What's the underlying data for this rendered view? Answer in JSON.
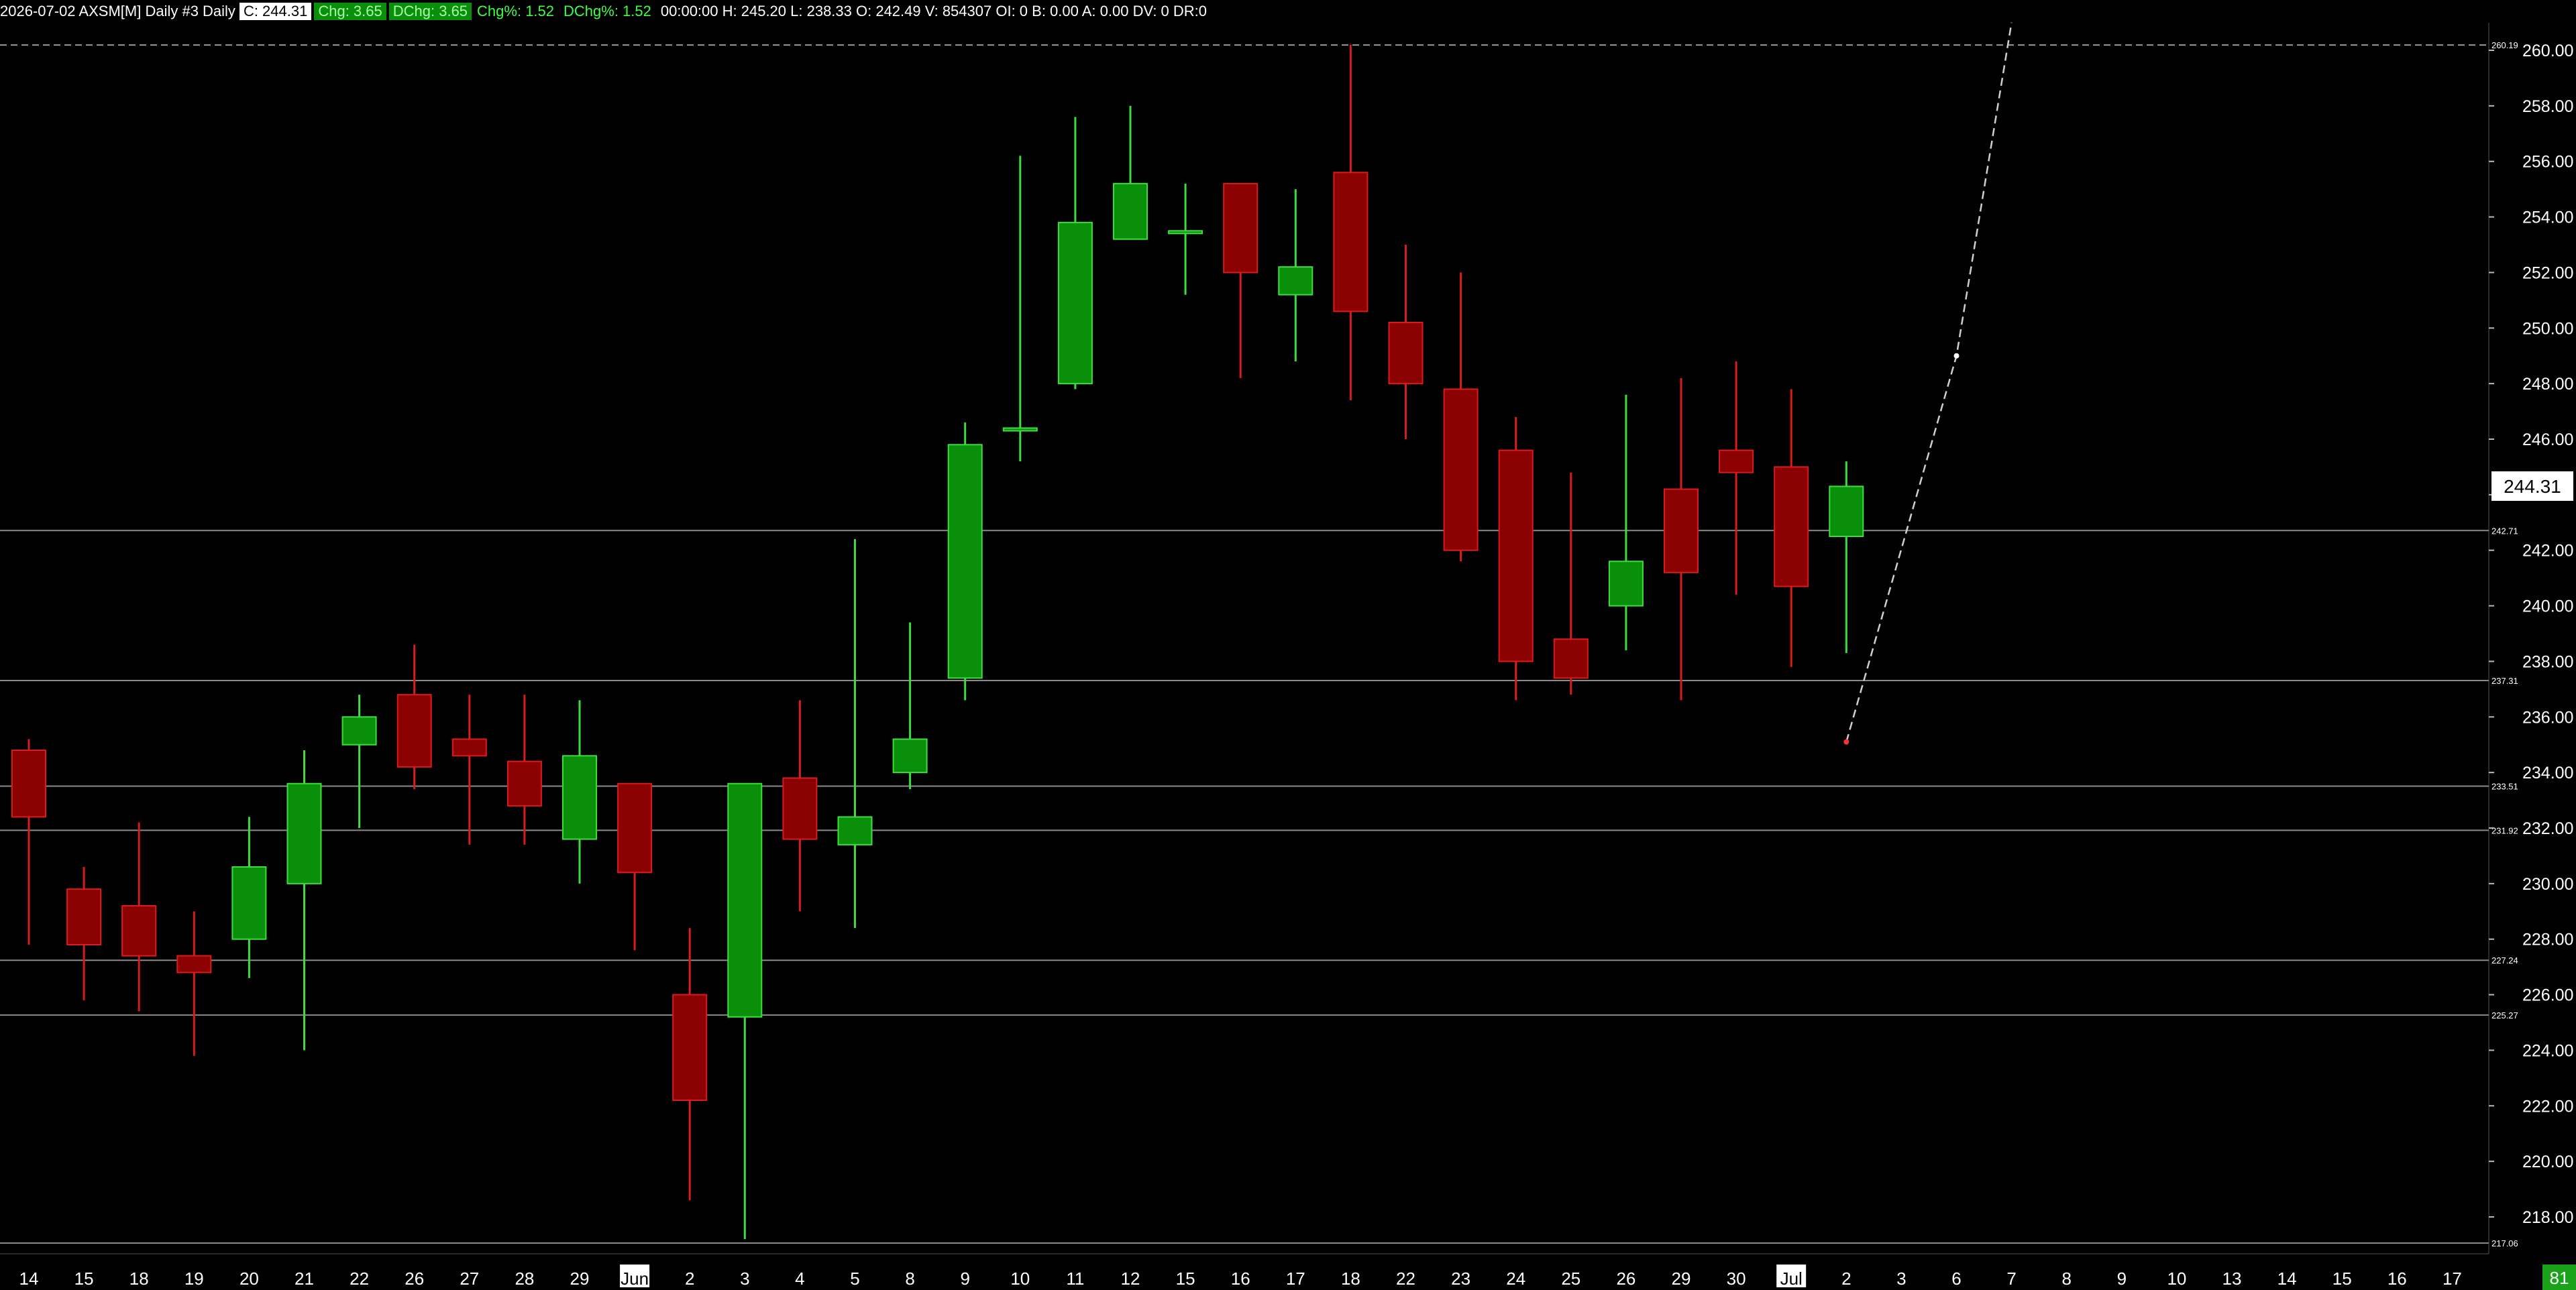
{
  "header": {
    "symbol_line": "2026-07-02 AXSM[M]  Daily #3 Daily",
    "close": "C: 244.31",
    "chg": "Chg: 3.65",
    "dchg": "DChg: 3.65",
    "chgpct": "Chg%: 1.52",
    "dchgpct": "DChg%: 1.52",
    "rest": "00:00:00  H: 245.20  L: 238.33  O: 242.49  V: 854307  OI: 0  B: 0.00  A: 0.00  DV: 0  DR:0"
  },
  "colors": {
    "up": "#0a8f0a",
    "up_wick": "#3ddc3d",
    "down": "#8b0000",
    "down_wick": "#d81b1b",
    "grid": "#8a8a8a",
    "background": "#000000"
  },
  "chart_data": {
    "type": "candlestick",
    "ylim": [
      216.5,
      262.0
    ],
    "y_ticks": [
      218,
      220,
      222,
      224,
      226,
      228,
      230,
      232,
      234,
      236,
      238,
      240,
      242,
      244,
      246,
      248,
      250,
      252,
      254,
      256,
      258,
      260
    ],
    "x_labels": [
      "14",
      "15",
      "18",
      "19",
      "20",
      "21",
      "22",
      "26",
      "27",
      "28",
      "29",
      "Jun",
      "2",
      "3",
      "4",
      "5",
      "8",
      "9",
      "10",
      "11",
      "12",
      "15",
      "16",
      "17",
      "18",
      "22",
      "23",
      "24",
      "25",
      "26",
      "29",
      "30",
      "Jul",
      "2",
      "3",
      "6",
      "7",
      "8",
      "9",
      "10",
      "13",
      "14",
      "15",
      "16",
      "17"
    ],
    "x_labels_highlighted": [
      "Jun",
      "Jul"
    ],
    "candles": [
      {
        "o": 234.8,
        "h": 235.2,
        "l": 227.8,
        "c": 232.4
      },
      {
        "o": 229.8,
        "h": 230.6,
        "l": 225.8,
        "c": 227.8
      },
      {
        "o": 229.2,
        "h": 232.2,
        "l": 225.4,
        "c": 227.4
      },
      {
        "o": 227.4,
        "h": 229.0,
        "l": 223.8,
        "c": 226.8
      },
      {
        "o": 228.0,
        "h": 232.4,
        "l": 226.6,
        "c": 230.6
      },
      {
        "o": 230.0,
        "h": 234.8,
        "l": 224.0,
        "c": 233.6
      },
      {
        "o": 235.0,
        "h": 236.8,
        "l": 232.0,
        "c": 236.0
      },
      {
        "o": 236.8,
        "h": 238.6,
        "l": 233.4,
        "c": 234.2
      },
      {
        "o": 235.2,
        "h": 236.8,
        "l": 231.4,
        "c": 234.6
      },
      {
        "o": 234.4,
        "h": 236.8,
        "l": 231.4,
        "c": 232.8
      },
      {
        "o": 231.6,
        "h": 236.6,
        "l": 230.0,
        "c": 234.6
      },
      {
        "o": 233.6,
        "h": 233.6,
        "l": 227.6,
        "c": 230.4
      },
      {
        "o": 226.0,
        "h": 228.4,
        "l": 218.6,
        "c": 222.2
      },
      {
        "o": 225.2,
        "h": 233.6,
        "l": 217.2,
        "c": 233.6
      },
      {
        "o": 233.8,
        "h": 236.6,
        "l": 229.0,
        "c": 231.6
      },
      {
        "o": 231.4,
        "h": 242.4,
        "l": 228.4,
        "c": 232.4
      },
      {
        "o": 234.0,
        "h": 239.4,
        "l": 233.4,
        "c": 235.2
      },
      {
        "o": 237.4,
        "h": 246.6,
        "l": 236.6,
        "c": 245.8
      },
      {
        "o": 246.3,
        "h": 256.2,
        "l": 245.2,
        "c": 246.4
      },
      {
        "o": 248.0,
        "h": 257.6,
        "l": 247.8,
        "c": 253.8
      },
      {
        "o": 253.2,
        "h": 258.0,
        "l": 253.2,
        "c": 255.2
      },
      {
        "o": 253.5,
        "h": 255.2,
        "l": 251.2,
        "c": 253.5
      },
      {
        "o": 255.2,
        "h": 255.2,
        "l": 248.2,
        "c": 252.0
      },
      {
        "o": 251.2,
        "h": 255.0,
        "l": 248.8,
        "c": 252.2
      },
      {
        "o": 255.6,
        "h": 260.2,
        "l": 247.4,
        "c": 250.6
      },
      {
        "o": 250.2,
        "h": 253.0,
        "l": 246.0,
        "c": 248.0
      },
      {
        "o": 247.8,
        "h": 252.0,
        "l": 241.6,
        "c": 242.0
      },
      {
        "o": 245.6,
        "h": 246.8,
        "l": 236.6,
        "c": 238.0
      },
      {
        "o": 238.8,
        "h": 244.8,
        "l": 236.8,
        "c": 237.4
      },
      {
        "o": 240.0,
        "h": 247.6,
        "l": 238.4,
        "c": 241.6
      },
      {
        "o": 244.2,
        "h": 248.2,
        "l": 236.6,
        "c": 241.2
      },
      {
        "o": 245.6,
        "h": 248.8,
        "l": 240.4,
        "c": 244.8
      },
      {
        "o": 245.0,
        "h": 247.8,
        "l": 237.8,
        "c": 240.7
      },
      {
        "o": 242.5,
        "h": 245.2,
        "l": 238.3,
        "c": 244.3
      }
    ],
    "h_lines": [
      {
        "value": 260.19,
        "label": "260.19",
        "style": "dashed"
      },
      {
        "value": 242.71,
        "label": "242.71",
        "style": "solid"
      },
      {
        "value": 237.31,
        "label": "237.31",
        "style": "solid"
      },
      {
        "value": 233.51,
        "label": "233.51",
        "style": "solid"
      },
      {
        "value": 231.92,
        "label": "231.92",
        "style": "solid"
      },
      {
        "value": 227.24,
        "label": "227.24",
        "style": "solid"
      },
      {
        "value": 225.27,
        "label": "225.27",
        "style": "solid"
      },
      {
        "value": 217.06,
        "label": "217.06",
        "style": "solid"
      }
    ],
    "projection": [
      {
        "slot": 33,
        "value": 235.1
      },
      {
        "slot": 35,
        "value": 249.0
      },
      {
        "slot": 36,
        "value": 261.0
      }
    ],
    "price_tag": "244.31",
    "corner_tag": "81"
  }
}
